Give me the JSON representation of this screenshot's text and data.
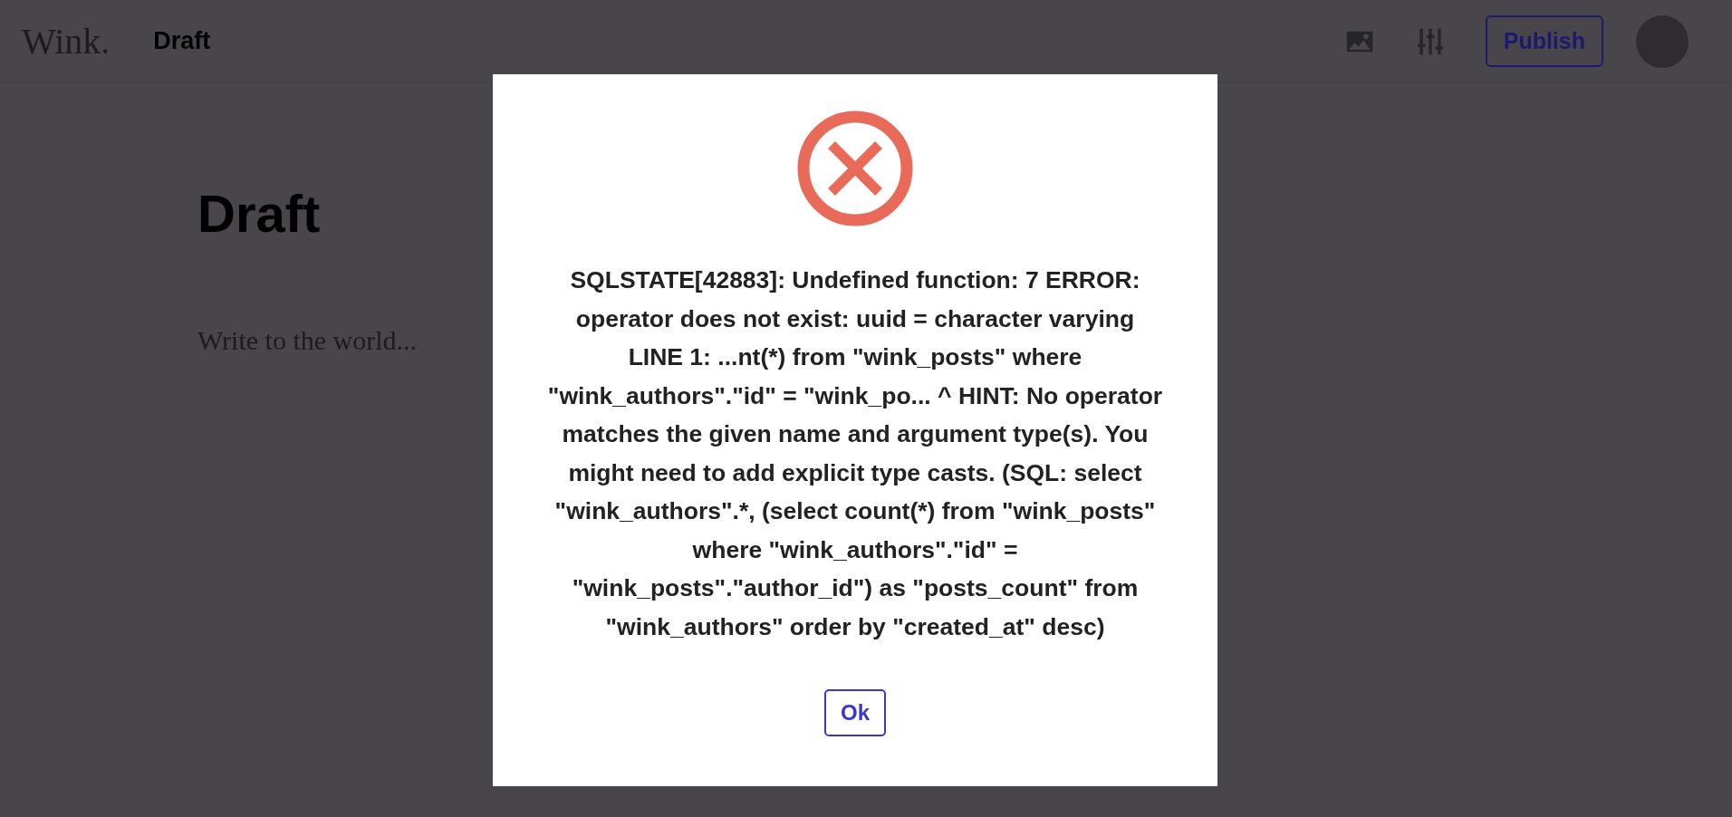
{
  "header": {
    "logo": "Wink.",
    "title": "Draft",
    "publish_button": "Publish"
  },
  "editor": {
    "title": "Draft",
    "placeholder": "Write to the world..."
  },
  "dialog": {
    "message": "SQLSTATE[42883]: Undefined function: 7 ERROR: operator does not exist: uuid = character varying LINE 1: ...nt(*) from \"wink_posts\" where \"wink_authors\".\"id\" = \"wink_po... ^ HINT: No operator matches the given name and argument type(s). You might need to add explicit type casts. (SQL: select \"wink_authors\".*, (select count(*) from \"wink_posts\" where \"wink_authors\".\"id\" = \"wink_posts\".\"author_id\") as \"posts_count\" from \"wink_authors\" order by \"created_at\" desc)",
    "button": "Ok"
  }
}
